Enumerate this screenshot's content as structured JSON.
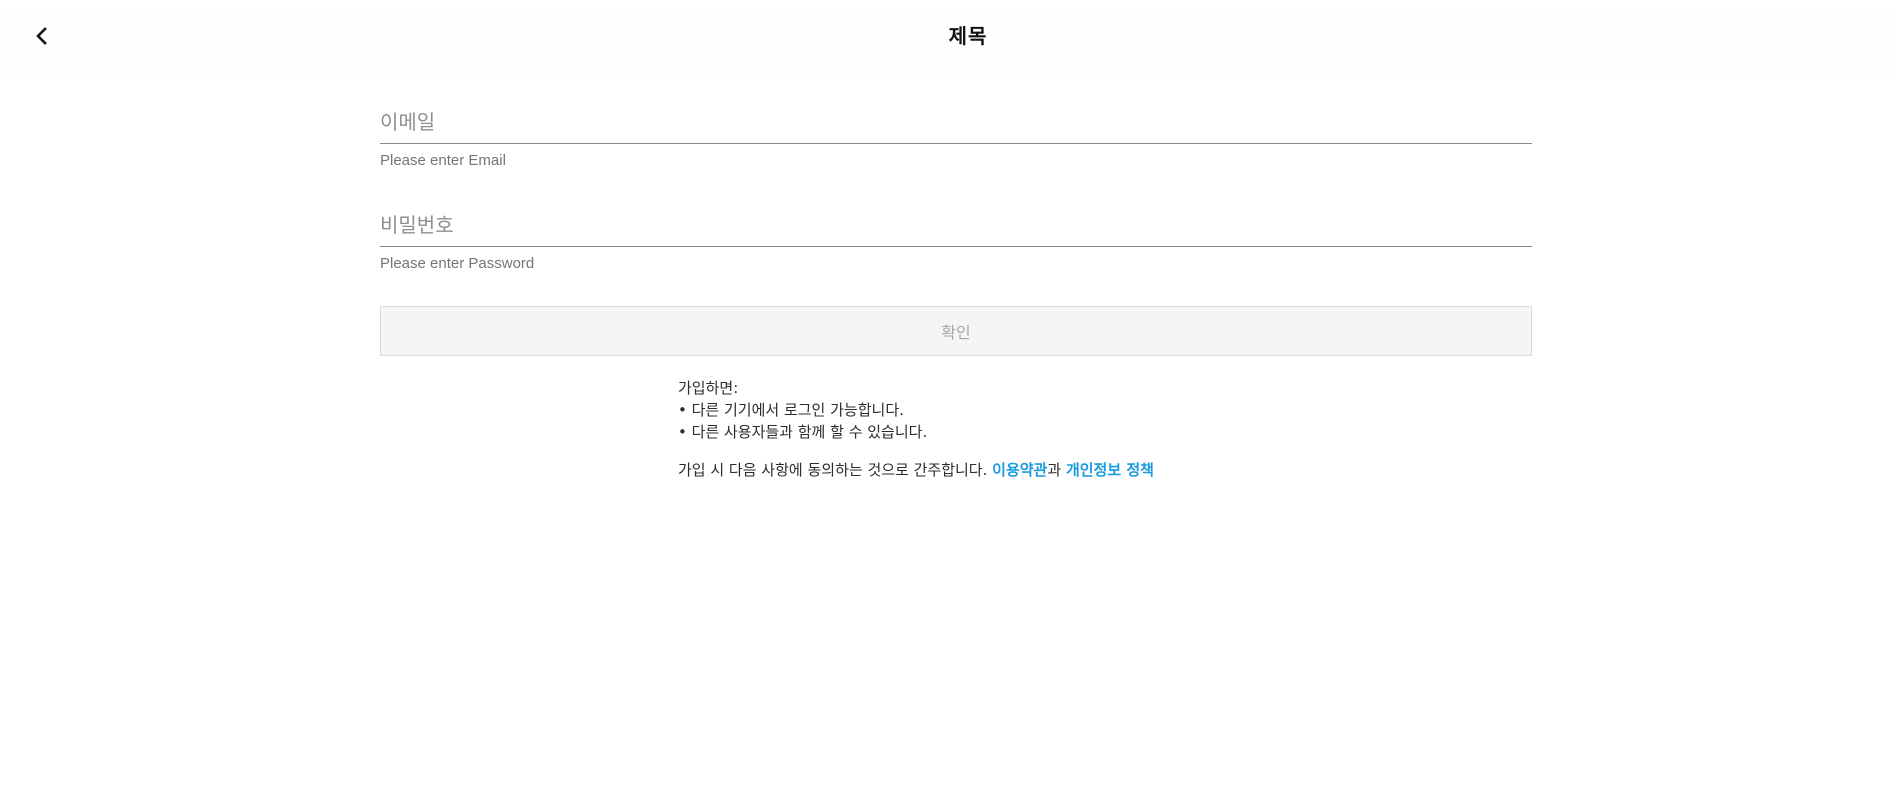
{
  "header": {
    "back_icon": "chevron-left-icon",
    "title": "제목"
  },
  "form": {
    "email": {
      "placeholder": "이메일",
      "value": "",
      "helper": "Please enter Email"
    },
    "password": {
      "placeholder": "비밀번호",
      "value": "",
      "helper": "Please enter Password"
    },
    "confirm_label": "확인"
  },
  "info": {
    "heading": "가입하면:",
    "bullets": [
      "• 다른 기기에서 로그인 가능합니다.",
      "• 다른 사용자들과 함께 할 수 있습니다."
    ],
    "terms_prefix": "가입 시 다음 사항에 동의하는 것으로 간주합니다. ",
    "terms_link": "이용약관",
    "terms_connector": "과 ",
    "privacy_link": "개인정보 정책"
  },
  "colors": {
    "link": "#1a9be0",
    "button_bg": "#f5f5f5",
    "button_text": "#a7a7a7"
  }
}
